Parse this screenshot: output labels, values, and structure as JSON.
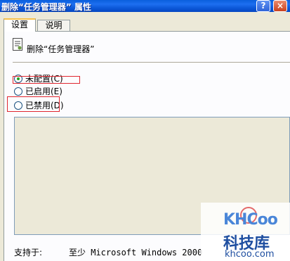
{
  "window": {
    "title": "删除“任务管理器” 属性",
    "help_glyph": "?",
    "close_glyph": "×"
  },
  "tabs": [
    {
      "label": "设置",
      "selected": true
    },
    {
      "label": "说明",
      "selected": false
    }
  ],
  "policy": {
    "icon": "policy-icon",
    "name": "删除“任务管理器”"
  },
  "options": [
    {
      "label": "未配置(C)",
      "checked": true
    },
    {
      "label": "已启用(E)",
      "checked": false
    },
    {
      "label": "已禁用(D)",
      "checked": false
    }
  ],
  "supported": {
    "label": "支持于:",
    "value": "至少 Microsoft Windows 2000"
  },
  "watermark": {
    "logo": "KHCoo",
    "chinese": "科技库",
    "url": "khcoo.com"
  },
  "colors": {
    "titlebar": "#0a5fdc",
    "highlight": "#e0262f",
    "radio_dot": "#21a121"
  }
}
